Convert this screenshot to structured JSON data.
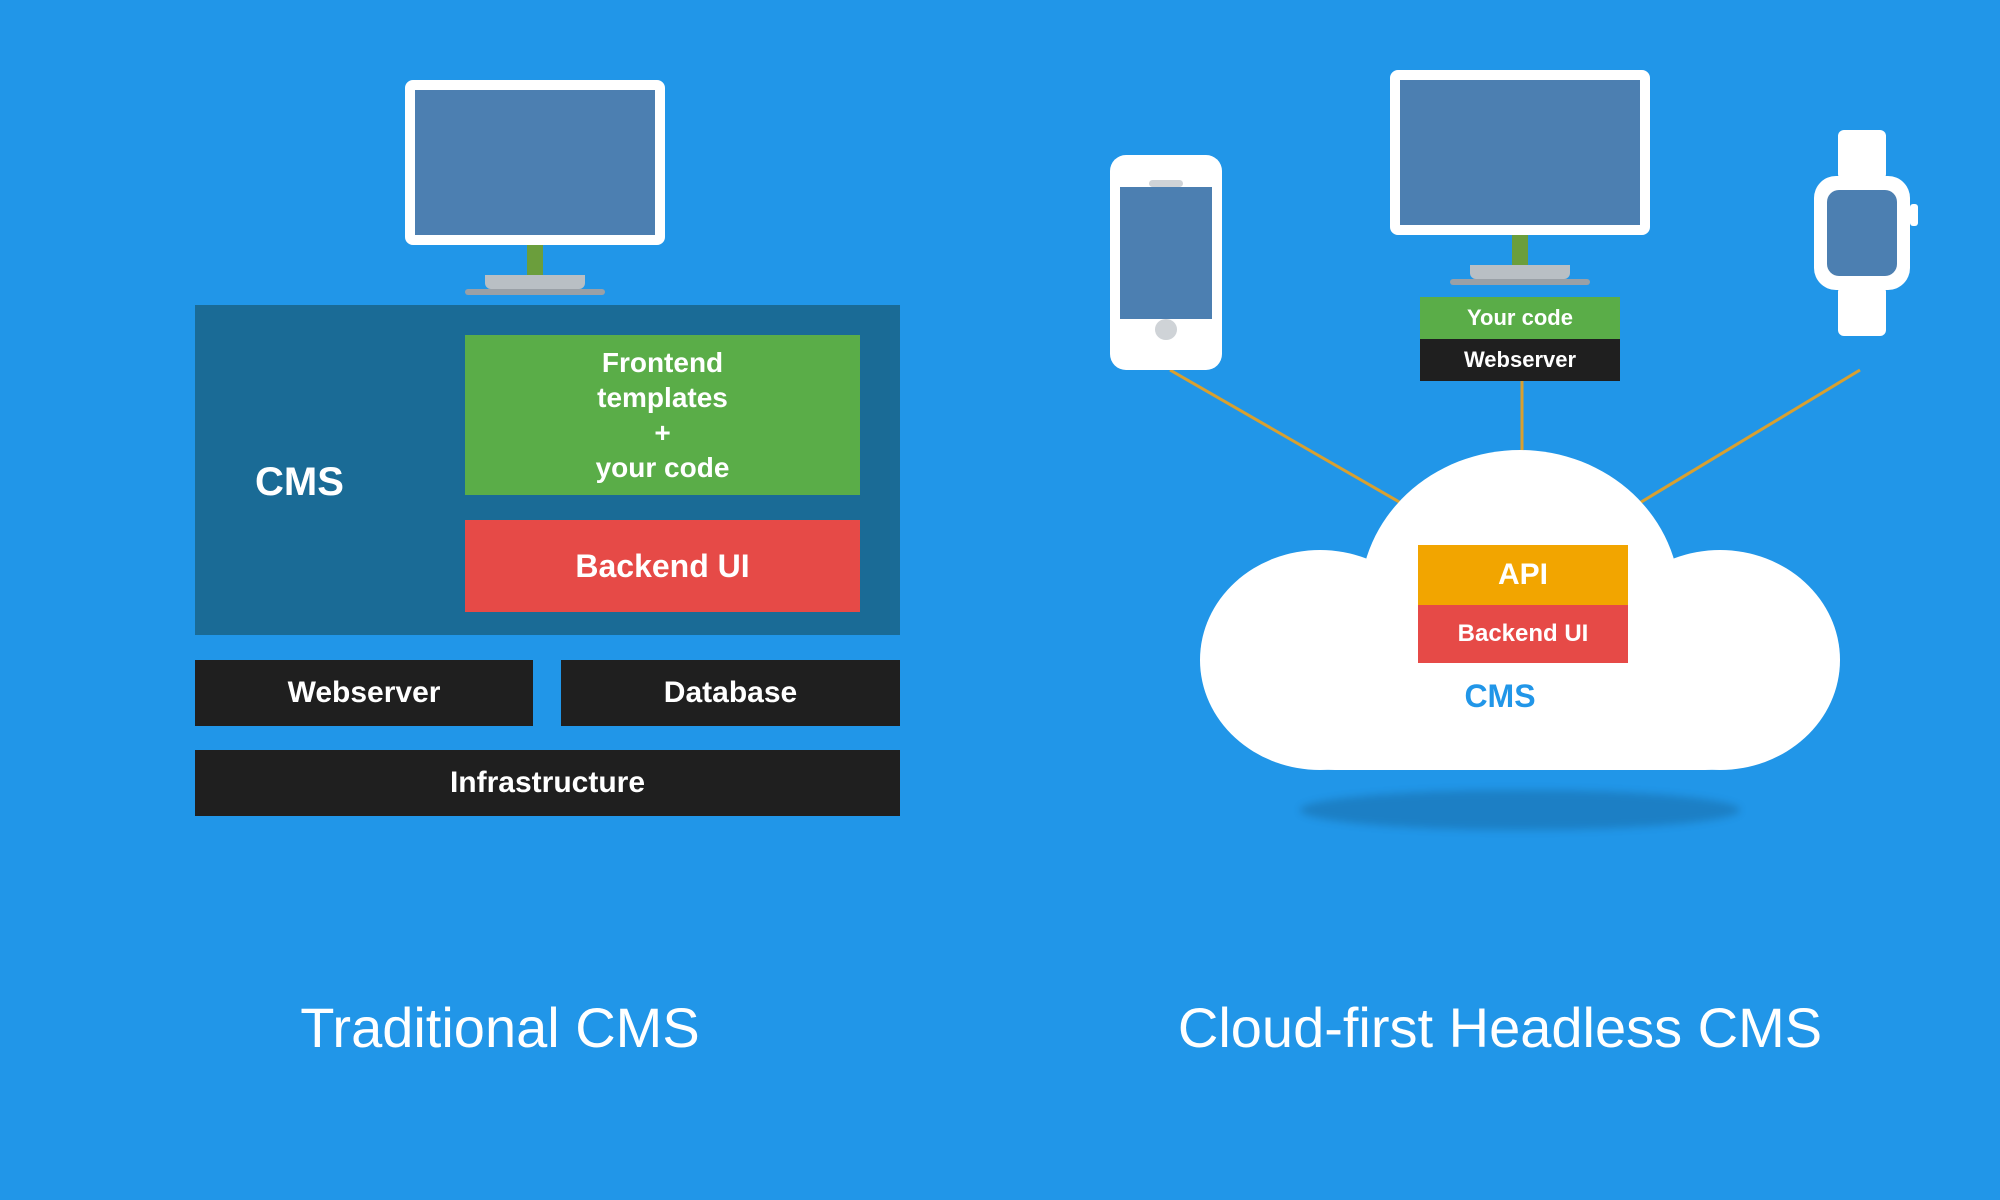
{
  "captions": {
    "left": "Traditional CMS",
    "right": "Cloud-first Headless CMS"
  },
  "left": {
    "cms": "CMS",
    "frontend": "Frontend\ntemplates\n+\nyour code",
    "backend": "Backend UI",
    "webserver": "Webserver",
    "database": "Database",
    "infrastructure": "Infrastructure"
  },
  "right": {
    "yourcode": "Your code",
    "webserver": "Webserver",
    "api": "API",
    "backend": "Backend UI",
    "cms": "CMS"
  },
  "colors": {
    "bg": "#2196e8",
    "cmsBox": "#1a6b96",
    "green": "#5aad48",
    "red": "#e64a47",
    "dark": "#1f1f1f",
    "orange": "#f2a500",
    "white": "#ffffff",
    "screen": "#4c7fb1"
  }
}
